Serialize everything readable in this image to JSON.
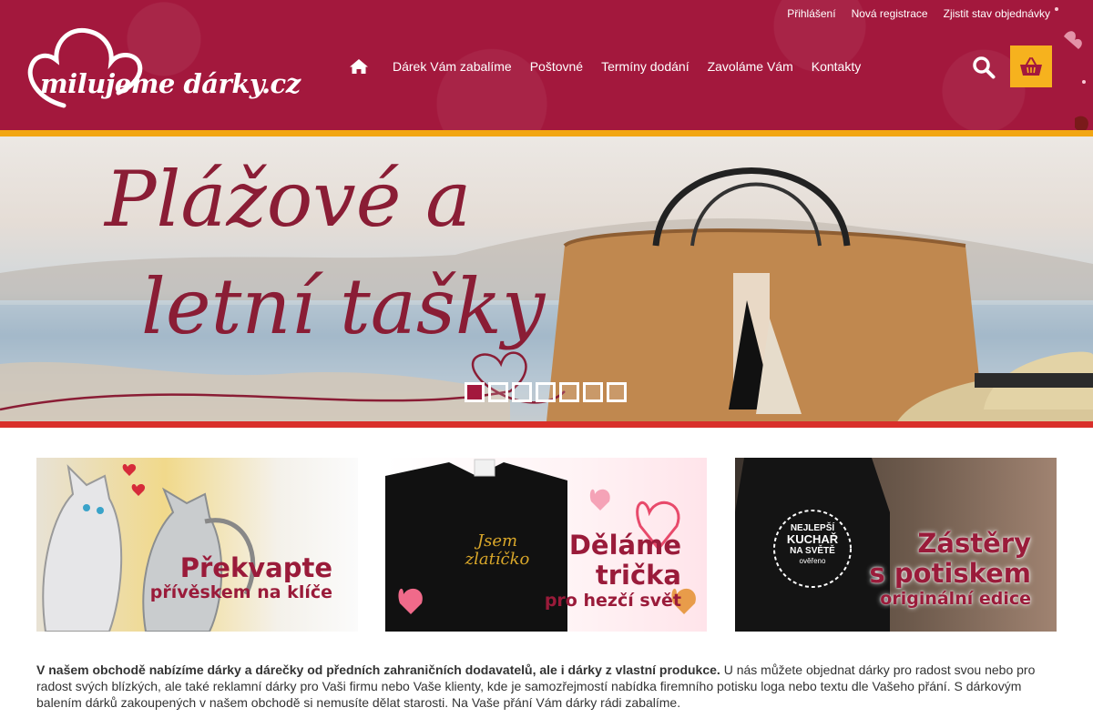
{
  "top_links": [
    "Přihlášení",
    "Nová registrace",
    "Zjistit stav objednávky"
  ],
  "logo": {
    "text": "milujeme dárky.cz"
  },
  "nav": {
    "items": [
      "Dárek Vám zabalíme",
      "Poštovné",
      "Termíny dodání",
      "Zavoláme Vám",
      "Kontakty"
    ]
  },
  "icons": {
    "home": "home-icon",
    "search": "search-icon",
    "cart": "shopping-basket-icon"
  },
  "colors": {
    "header": "#a3183d",
    "accent_yellow": "#f6b21e",
    "accent_red": "#d92f2a",
    "brand_text": "#8a1d35"
  },
  "hero": {
    "line1": "Plážové a",
    "line2": "letní tašky",
    "slides_count": 7,
    "active_slide": 1
  },
  "banners": [
    {
      "line1": "Překvapte",
      "line2": "přívěskem na klíče"
    },
    {
      "badge": "Jsem zlatíčko",
      "line1": "Děláme",
      "line2": "trička",
      "line3": "pro hezčí svět"
    },
    {
      "badge_lines": [
        "NEJLEPŠÍ",
        "KUCHAŘ",
        "NA SVĚTĚ",
        "ověřeno"
      ],
      "line1": "Zástěry",
      "line2": "s potiskem",
      "line3": "originální edice"
    }
  ],
  "intro": {
    "bold": "V našem obchodě nabízíme dárky a dárečky od předních zahraničních dodavatelů, ale i dárky z vlastní produkce.",
    "rest": " U nás můžete objednat dárky pro radost svou nebo pro radost svých blízkých, ale také reklamní dárky pro Vaši firmu nebo Vaše klienty, kde je samozřejmostí nabídka firemního potisku loga nebo textu dle Vašeho přání. S dárkovým balením dárků zakoupených v našem obchodě si nemusíte dělat starosti. Na Vaše přání Vám dárky rádi zabalíme."
  }
}
